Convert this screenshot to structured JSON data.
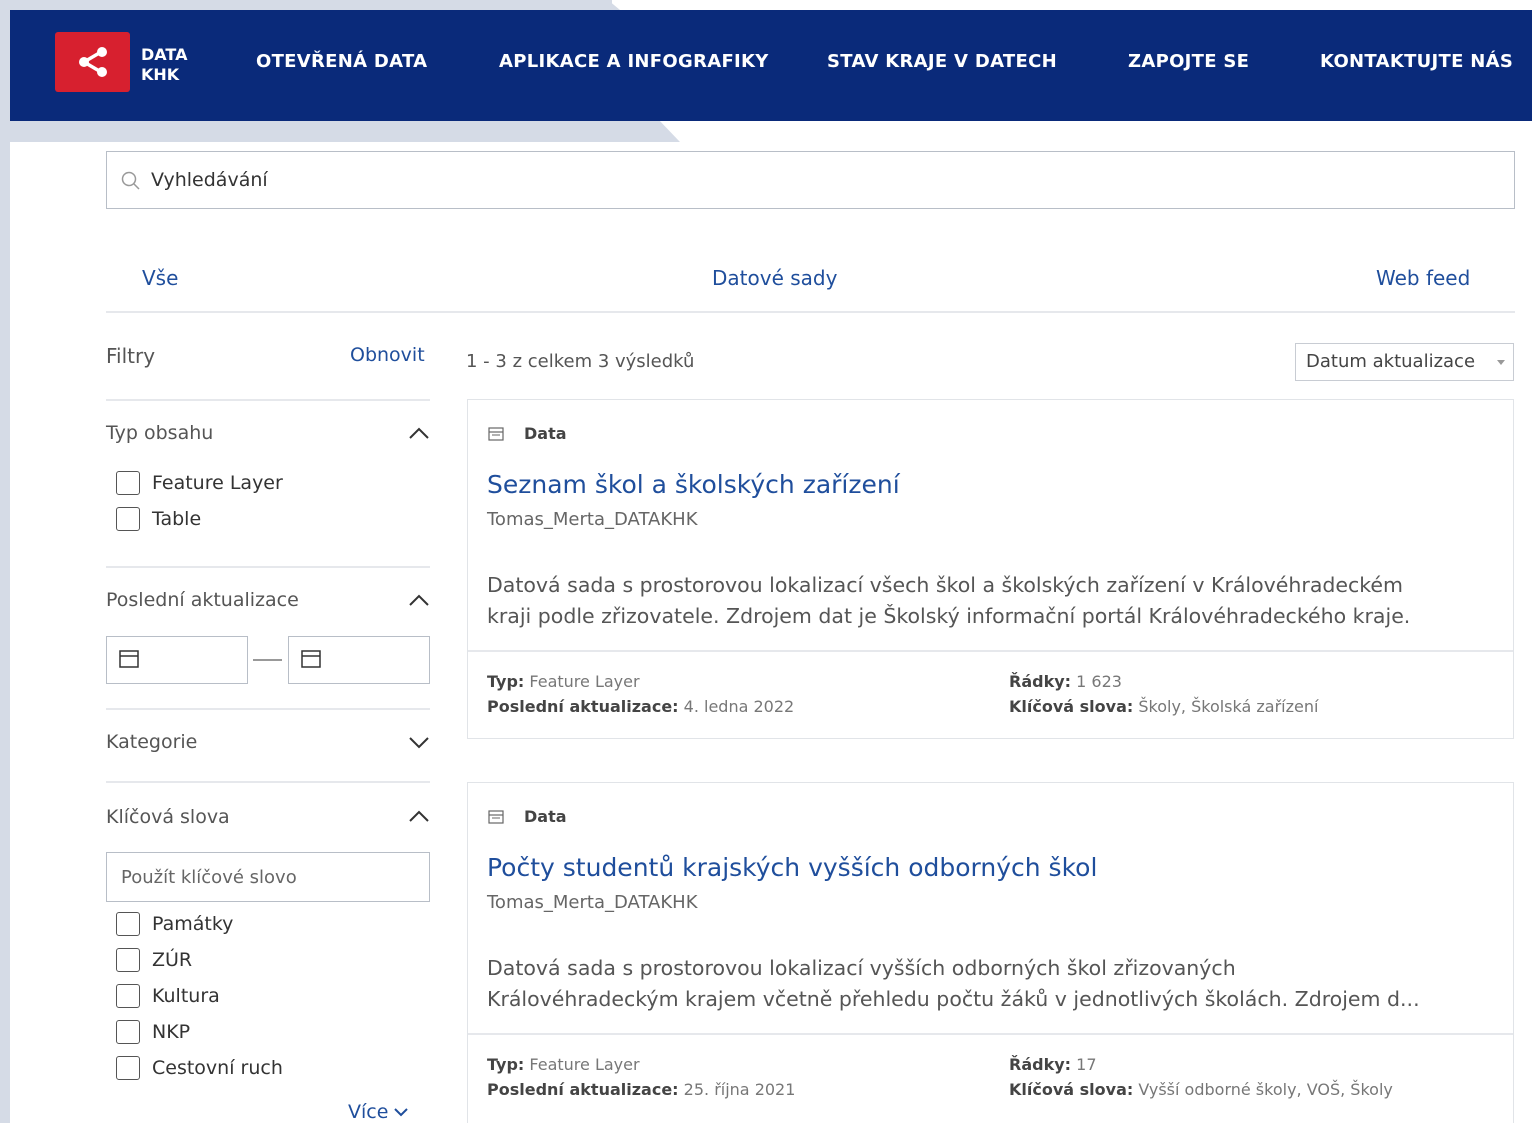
{
  "brand": {
    "logo_line1": "DATA",
    "logo_line2": "KHK"
  },
  "nav": {
    "items": [
      "OTEVŘENÁ DATA",
      "APLIKACE A INFOGRAFIKY",
      "STAV KRAJE V DATECH",
      "ZAPOJTE SE",
      "KONTAKTUJTE NÁS"
    ]
  },
  "search": {
    "placeholder": "Vyhledávání"
  },
  "tabs": [
    "Vše",
    "Datové sady",
    "Web feed"
  ],
  "filters": {
    "title": "Filtry",
    "reset": "Obnovit",
    "content_type": {
      "title": "Typ obsahu",
      "options": [
        "Feature Layer",
        "Table"
      ]
    },
    "last_update": {
      "title": "Poslední aktualizace"
    },
    "category": {
      "title": "Kategorie"
    },
    "keywords": {
      "title": "Klíčová slova",
      "placeholder": "Použít klíčové slovo",
      "options": [
        "Památky",
        "ZÚR",
        "Kultura",
        "NKP",
        "Cestovní ruch"
      ],
      "more": "Více"
    }
  },
  "results": {
    "count_text": "1 - 3 z celkem 3 výsledků",
    "sort": "Datum aktualizace",
    "items": [
      {
        "type_label": "Data",
        "title": "Seznam škol a školských zařízení",
        "owner": "Tomas_Merta_DATAKHK",
        "desc_line1": "Datová sada s prostorovou lokalizací všech škol a školských zařízení v Královéhradeckém",
        "desc_line2": "kraji podle zřizovatele. Zdrojem dat je Školský informační portál Královéhradeckého kraje.",
        "type_key": "Typ:",
        "type_value": "Feature Layer",
        "updated_key": "Poslední aktualizace:",
        "updated_value": "4. ledna 2022",
        "rows_key": "Řádky:",
        "rows_value": "1 623",
        "keywords_key": "Klíčová slova:",
        "keywords_value": "Školy, Školská zařízení"
      },
      {
        "type_label": "Data",
        "title": "Počty studentů krajských vyšších odborných škol",
        "owner": "Tomas_Merta_DATAKHK",
        "desc_line1": "Datová sada s prostorovou lokalizací vyšších odborných škol zřizovaných",
        "desc_line2": "Královéhradeckým krajem včetně přehledu počtu žáků v jednotlivých školách. Zdrojem d...",
        "type_key": "Typ:",
        "type_value": "Feature Layer",
        "updated_key": "Poslední aktualizace:",
        "updated_value": "25. října 2021",
        "rows_key": "Řádky:",
        "rows_value": "17",
        "keywords_key": "Klíčová slova:",
        "keywords_value": "Vyšší odborné školy, VOŠ, Školy"
      }
    ]
  },
  "colors": {
    "nav_bg": "#0a2a7a",
    "logo_red": "#d7202f",
    "link_blue": "#1f4e9c"
  }
}
